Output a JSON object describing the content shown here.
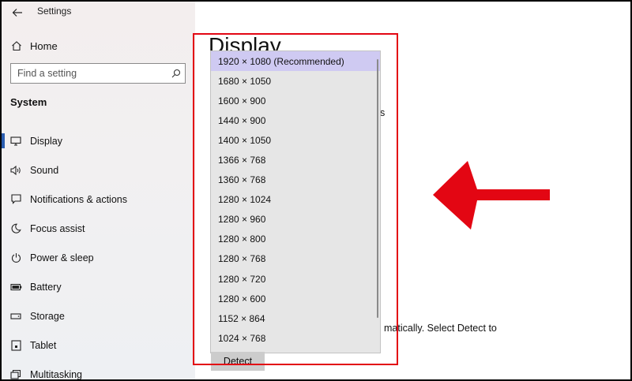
{
  "window": {
    "title": "Settings"
  },
  "sidebar": {
    "home_label": "Home",
    "search_placeholder": "Find a setting",
    "section_label": "System",
    "items": [
      {
        "label": "Display",
        "icon": "monitor-icon",
        "active": true
      },
      {
        "label": "Sound",
        "icon": "speaker-icon"
      },
      {
        "label": "Notifications & actions",
        "icon": "notification-icon"
      },
      {
        "label": "Focus assist",
        "icon": "moon-icon"
      },
      {
        "label": "Power & sleep",
        "icon": "power-icon"
      },
      {
        "label": "Battery",
        "icon": "battery-icon"
      },
      {
        "label": "Storage",
        "icon": "storage-icon"
      },
      {
        "label": "Tablet",
        "icon": "tablet-icon"
      },
      {
        "label": "Multitasking",
        "icon": "multitasking-icon"
      }
    ]
  },
  "main": {
    "title": "Display",
    "partial_text_1": "s",
    "partial_text_2": "matically. Select Detect to",
    "detect_button": "Detect"
  },
  "resolution_dropdown": {
    "selected_index": 0,
    "options": [
      "1920 × 1080 (Recommended)",
      "1680 × 1050",
      "1600 × 900",
      "1440 × 900",
      "1400 × 1050",
      "1366 × 768",
      "1360 × 768",
      "1280 × 1024",
      "1280 × 960",
      "1280 × 800",
      "1280 × 768",
      "1280 × 720",
      "1280 × 600",
      "1152 × 864",
      "1024 × 768"
    ]
  },
  "annotation": {
    "color": "#e30613"
  }
}
